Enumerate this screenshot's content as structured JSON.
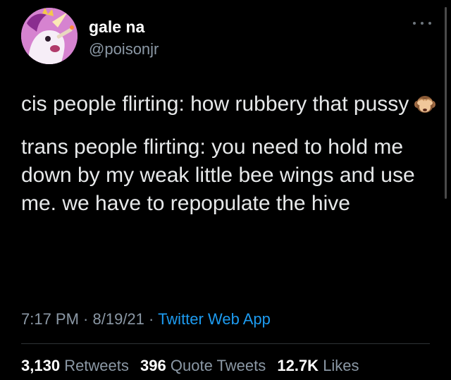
{
  "author": {
    "display_name": "gale na",
    "handle": "@poisonjr"
  },
  "tweet": {
    "line1": "cis people flirting: how rubbery that pussy",
    "line1_emoji": "see-no-evil-monkey-icon",
    "line2": "trans people flirting: you need to hold me down by my weak little bee wings and use me. we have to repopulate the hive"
  },
  "meta": {
    "time": "7:17 PM",
    "sep1": " · ",
    "date": "8/19/21",
    "sep2": " · ",
    "source": "Twitter Web App"
  },
  "stats": {
    "retweets_count": "3,130",
    "retweets_label": "Retweets",
    "quotes_count": "396",
    "quotes_label": "Quote Tweets",
    "likes_count": "12.7K",
    "likes_label": "Likes"
  },
  "colors": {
    "background": "#000000",
    "text": "#e7e9ea",
    "secondary": "#8b98a5",
    "link": "#1d9bf0"
  }
}
